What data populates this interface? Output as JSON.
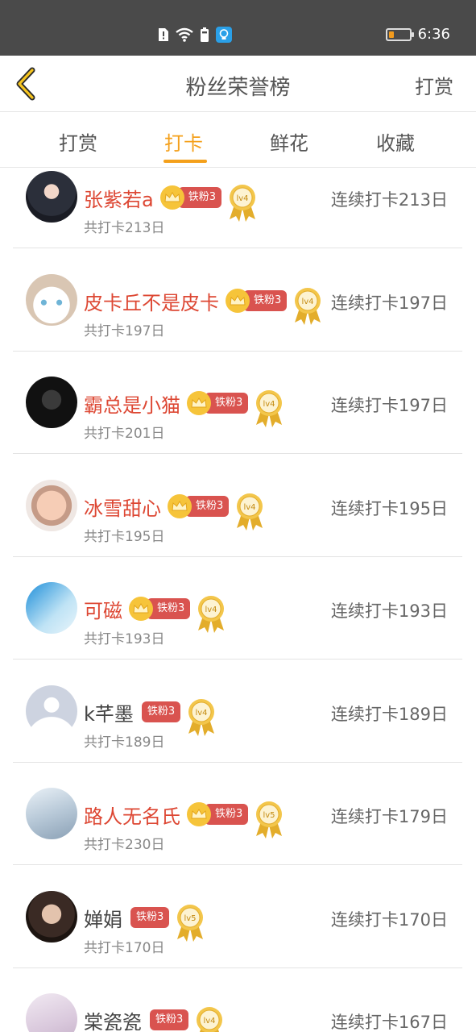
{
  "status_bar": {
    "time": "6:36",
    "icons": [
      "alert-icon",
      "wifi-icon",
      "sim-battery-icon",
      "bulb-app-icon"
    ],
    "battery_level": 0.25
  },
  "header": {
    "title": "粉丝荣誉榜",
    "action_label": "打赏"
  },
  "tabs": [
    {
      "label": "打赏",
      "active": false
    },
    {
      "label": "打卡",
      "active": true
    },
    {
      "label": "鲜花",
      "active": false
    },
    {
      "label": "收藏",
      "active": false
    }
  ],
  "colors": {
    "accent": "#f4a01b",
    "name_highlight": "#dd4733",
    "badge": "#d9534f",
    "crown": "#f6c43a"
  },
  "rows": [
    {
      "name": "张紫若a",
      "crown": true,
      "badge": "铁粉3",
      "level": "lv4",
      "total": "共打卡213日",
      "streak": "连续打卡213日",
      "highlight": true
    },
    {
      "name": "皮卡丘不是皮卡",
      "crown": true,
      "badge": "铁粉3",
      "level": "lv4",
      "total": "共打卡197日",
      "streak": "连续打卡197日",
      "highlight": true
    },
    {
      "name": "霸总是小猫",
      "crown": true,
      "badge": "铁粉3",
      "level": "lv4",
      "total": "共打卡201日",
      "streak": "连续打卡197日",
      "highlight": true
    },
    {
      "name": "冰雪甜心",
      "crown": true,
      "badge": "铁粉3",
      "level": "lv4",
      "total": "共打卡195日",
      "streak": "连续打卡195日",
      "highlight": true
    },
    {
      "name": "可磁",
      "crown": true,
      "badge": "铁粉3",
      "level": "lv4",
      "total": "共打卡193日",
      "streak": "连续打卡193日",
      "highlight": true
    },
    {
      "name": "k芊墨",
      "crown": false,
      "badge": "铁粉3",
      "level": "lv4",
      "total": "共打卡189日",
      "streak": "连续打卡189日",
      "highlight": false
    },
    {
      "name": "路人无名氏",
      "crown": true,
      "badge": "铁粉3",
      "level": "lv5",
      "total": "共打卡230日",
      "streak": "连续打卡179日",
      "highlight": true
    },
    {
      "name": "婵娟",
      "crown": false,
      "badge": "铁粉3",
      "level": "lv5",
      "total": "共打卡170日",
      "streak": "连续打卡170日",
      "highlight": false
    },
    {
      "name": "棠瓷瓷",
      "crown": false,
      "badge": "铁粉3",
      "level": "lv4",
      "total": "",
      "streak": "连续打卡167日",
      "highlight": false
    }
  ]
}
